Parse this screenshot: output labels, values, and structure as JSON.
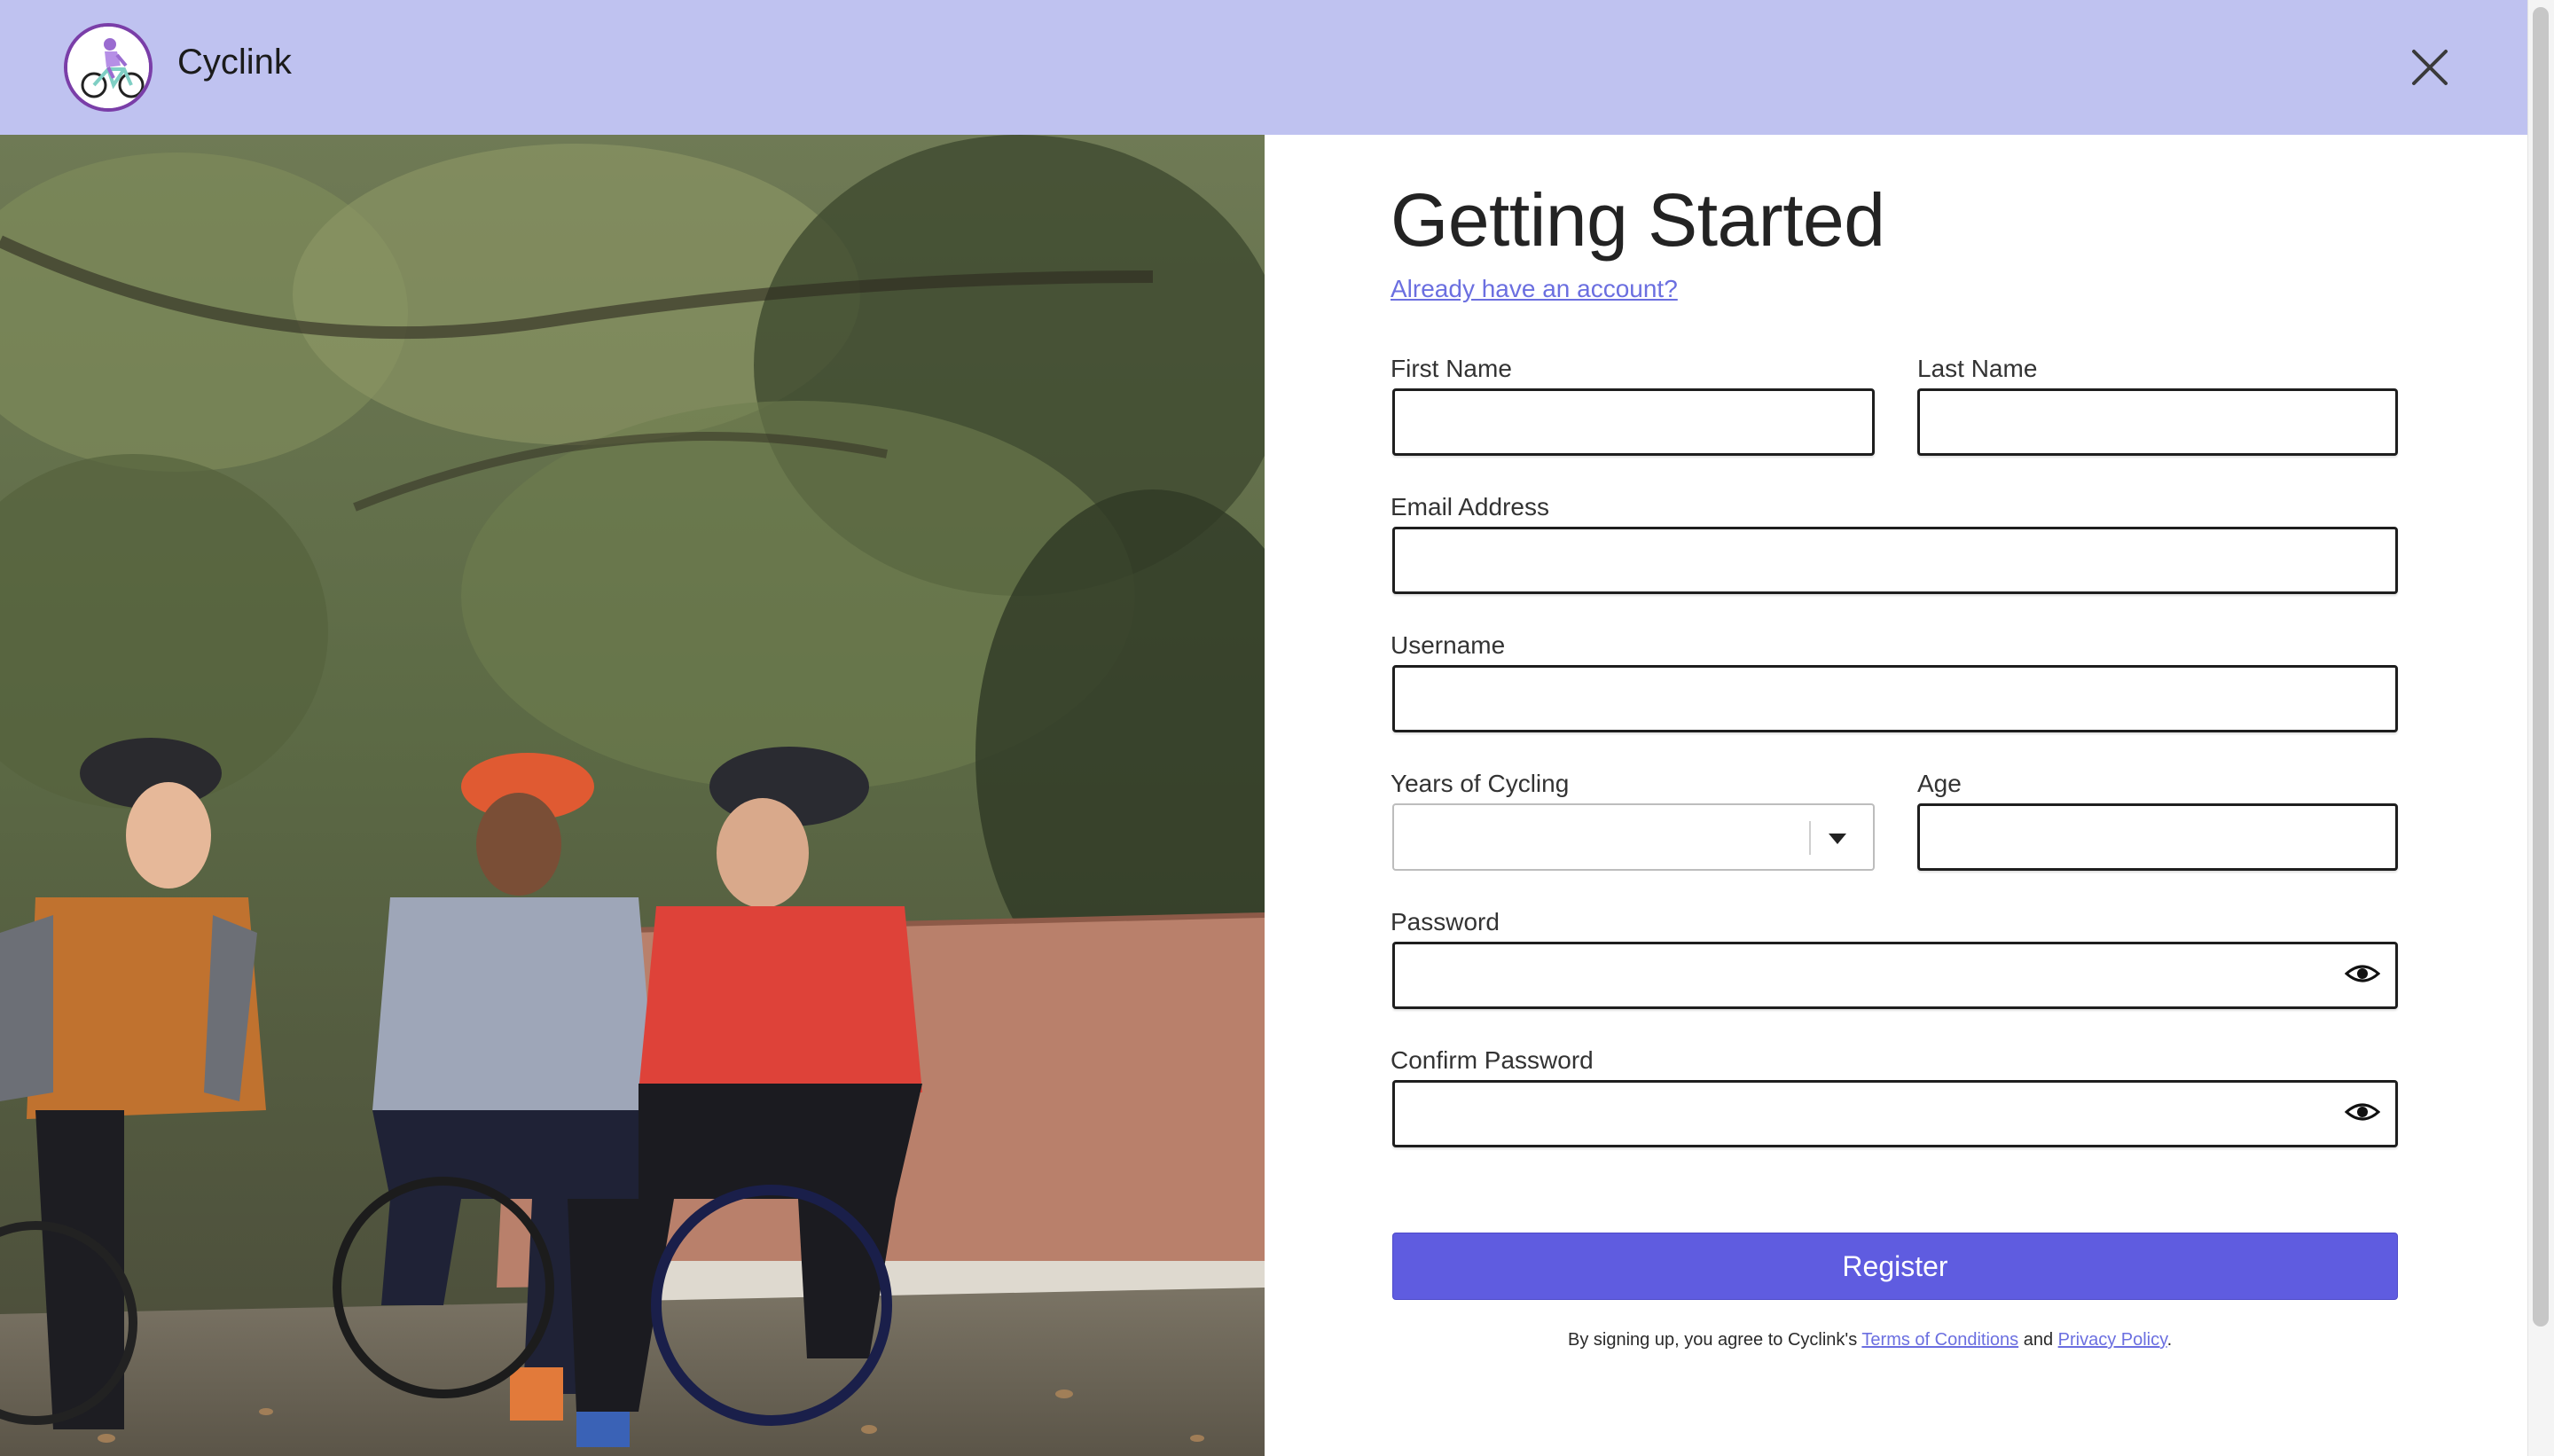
{
  "header": {
    "app_name": "Cyclink",
    "background": "#bfc2f0",
    "logo_icon": "cyclist-logo-icon",
    "close_icon": "close-icon"
  },
  "form": {
    "title": "Getting Started",
    "signin_link": "Already have an account?",
    "fields": {
      "first_name": {
        "label": "First Name",
        "value": "",
        "placeholder": ""
      },
      "last_name": {
        "label": "Last Name",
        "value": "",
        "placeholder": ""
      },
      "email": {
        "label": "Email Address",
        "value": "",
        "placeholder": ""
      },
      "username": {
        "label": "Username",
        "value": "",
        "placeholder": ""
      },
      "years_cycling": {
        "label": "Years of Cycling",
        "selected": ""
      },
      "age": {
        "label": "Age",
        "value": "",
        "placeholder": ""
      },
      "password": {
        "label": "Password",
        "value": "",
        "placeholder": ""
      },
      "confirm_password": {
        "label": "Confirm Password",
        "value": "",
        "placeholder": ""
      }
    },
    "register_label": "Register",
    "terms": {
      "prefix": "By signing up, you agree to Cyclink's ",
      "terms_link": "Terms of Conditions",
      "middle": " and ",
      "privacy_link": "Privacy Policy",
      "suffix": "."
    },
    "accent": "#5f5ce0",
    "link_color": "#6b6fe0"
  }
}
